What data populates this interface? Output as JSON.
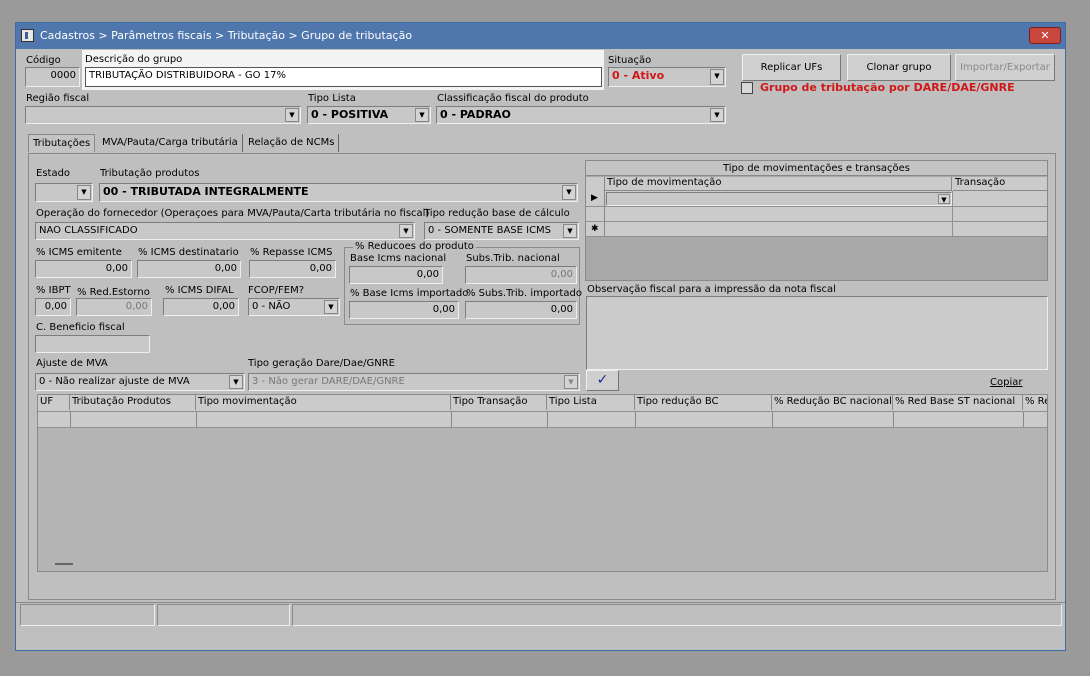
{
  "window": {
    "title": "Cadastros > Parâmetros fiscais > Tributação > Grupo de tributação",
    "close_label": "✕"
  },
  "header": {
    "codigo_label": "Código",
    "codigo_value": "0000",
    "descricao_label": "Descrição do grupo",
    "descricao_value": "TRIBUTAÇÃO DISTRIBUIDORA - GO 17%",
    "situacao_label": "Situação",
    "situacao_value": "0 - Ativo",
    "replicar_label": "Replicar UFs",
    "clonar_label": "Clonar grupo",
    "importar_label": "Importar/Exportar",
    "dare_label": "Grupo de tributação por DARE/DAE/GNRE",
    "regiao_label": "Região fiscal",
    "regiao_value": "",
    "tipo_lista_label": "Tipo Lista",
    "tipo_lista_value": "0 - POSITIVA",
    "classificacao_label": "Classificação fiscal do produto",
    "classificacao_value": "0 - PADRAO"
  },
  "tabs": [
    {
      "label": "Tributações"
    },
    {
      "label": "MVA/Pauta/Carga tributária"
    },
    {
      "label": "Relação de NCMs"
    }
  ],
  "form": {
    "estado_label": "Estado",
    "estado_value": "",
    "trib_prod_label": "Tributação produtos",
    "trib_prod_value": "00 - TRIBUTADA INTEGRALMENTE",
    "operacao_label": "Operação do fornecedor (Operaçoes para MVA/Pauta/Carta tributária no fiscal)",
    "operacao_value": "NAO CLASSIFICADO",
    "tipo_reducao_label": "Tipo redução base de cálculo",
    "tipo_reducao_value": "0 - SOMENTE BASE ICMS",
    "icms_emitente_label": "% ICMS emitente",
    "icms_emitente_value": "0,00",
    "icms_destinatario_label": "% ICMS destinatario",
    "icms_destinatario_value": "0,00",
    "repasse_label": "% Repasse ICMS",
    "repasse_value": "0,00",
    "reducoes_label": "% Reducoes do produto",
    "base_nacional_label": "Base Icms nacional",
    "base_nacional_value": "0,00",
    "subs_nacional_label": "Subs.Trib. nacional",
    "subs_nacional_value": "0,00",
    "base_importado_label": "% Base Icms importado",
    "base_importado_value": "0,00",
    "subs_importado_label": "% Subs.Trib. importado",
    "subs_importado_value": "0,00",
    "ibpt_label": "% IBPT",
    "ibpt_value": "0,00",
    "red_estorno_label": "% Red.Estorno",
    "red_estorno_value": "0,00",
    "icms_difal_label": "% ICMS DIFAL",
    "icms_difal_value": "0,00",
    "fcop_label": "FCOP/FEM?",
    "fcop_value": "0 - NÃO",
    "beneficio_label": "C. Beneficio fiscal",
    "beneficio_value": "",
    "ajuste_label": "Ajuste de MVA",
    "ajuste_value": "0 - Não realizar ajuste de MVA",
    "geracao_label": "Tipo geração Dare/Dae/GNRE",
    "geracao_value": "3 - Não gerar DARE/DAE/GNRE",
    "check_glyph": "✓",
    "copiar_label": "Copiar"
  },
  "mov": {
    "title": "Tipo de movimentações e transações",
    "col1": "Tipo de movimentação",
    "col2": "Transação",
    "row_marker": "▶",
    "new_marker": "✱"
  },
  "obs": {
    "label": "Observação fiscal para a impressão da nota fiscal",
    "value": ""
  },
  "table": {
    "columns": [
      "UF",
      "Tributação Produtos",
      "Tipo movimentação",
      "Tipo Transação",
      "Tipo Lista",
      "Tipo redução BC",
      "% Redução BC nacional",
      "% Red Base ST nacional",
      "% Re"
    ]
  },
  "icons": {
    "arrow": "chevron-down-icon",
    "check": "check-icon",
    "app": "app-icon"
  },
  "colors": {
    "title_bg": "#4f77ad",
    "red_text": "#d01818",
    "close_bg": "#c9463d"
  }
}
